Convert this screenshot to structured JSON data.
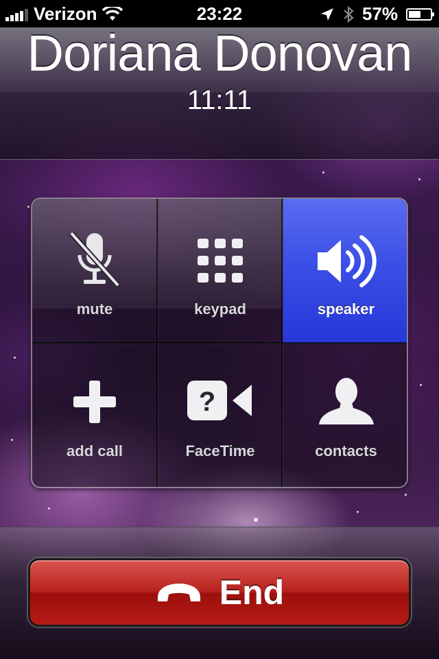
{
  "status_bar": {
    "carrier": "Verizon",
    "time": "23:22",
    "battery_percent": "57%",
    "battery_level": 0.57,
    "icons": [
      "signal-icon",
      "wifi-icon",
      "location-icon",
      "bluetooth-icon",
      "battery-icon"
    ]
  },
  "call": {
    "caller_name": "Doriana Donovan",
    "duration": "11:11"
  },
  "controls": {
    "mute_label": "mute",
    "keypad_label": "keypad",
    "speaker_label": "speaker",
    "add_call_label": "add call",
    "facetime_label": "FaceTime",
    "contacts_label": "contacts",
    "active": "speaker"
  },
  "end_button": {
    "label": "End"
  },
  "colors": {
    "speaker_active": "#3b4fe6",
    "end_red": "#b8231f"
  }
}
